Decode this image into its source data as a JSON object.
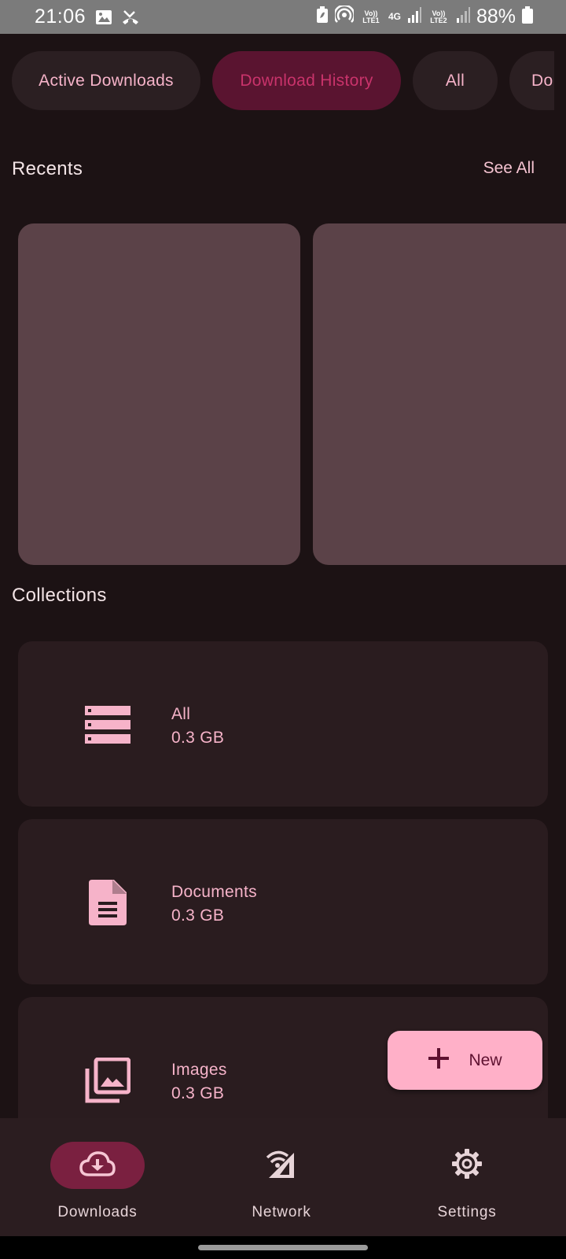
{
  "status_bar": {
    "time": "21:06",
    "net1": "Vo)) LTE1",
    "net_type": "4G",
    "net2": "Vo)) LTE2",
    "battery": "88%",
    "icons": [
      "image-icon",
      "missed-call-icon",
      "battery-saver-icon",
      "hotspot-icon",
      "signal-icon",
      "battery-icon"
    ]
  },
  "chips": [
    {
      "label": "Active Downloads",
      "selected": false
    },
    {
      "label": "Download History",
      "selected": true
    },
    {
      "label": "All",
      "selected": false
    },
    {
      "label": "Do",
      "selected": false
    }
  ],
  "recents": {
    "title": "Recents",
    "see_all": "See All"
  },
  "collections": {
    "title": "Collections",
    "items": [
      {
        "name": "All",
        "size": "0.3 GB",
        "icon": "storage-icon"
      },
      {
        "name": "Documents",
        "size": "0.3 GB",
        "icon": "document-icon"
      },
      {
        "name": "Images",
        "size": "0.3 GB",
        "icon": "images-icon"
      }
    ]
  },
  "fab": {
    "label": "New",
    "icon": "plus-icon"
  },
  "bottom_nav": {
    "items": [
      {
        "label": "Downloads",
        "icon": "cloud-download-icon",
        "active": true
      },
      {
        "label": "Network",
        "icon": "network-icon",
        "active": false
      },
      {
        "label": "Settings",
        "icon": "gear-icon",
        "active": false
      }
    ]
  },
  "colors": {
    "background": "#1c1214",
    "accent": "#ffb0c8",
    "active_chip": "#5a1430",
    "card": "#2a1c1f",
    "recent_card": "#5b4248"
  }
}
